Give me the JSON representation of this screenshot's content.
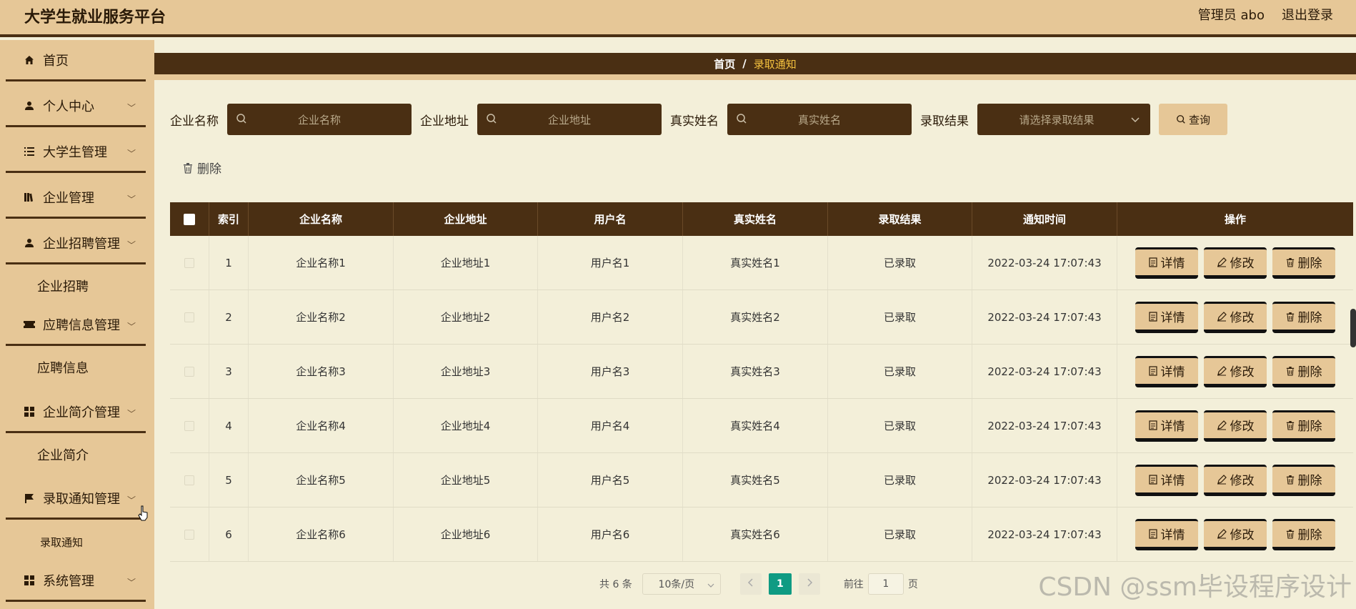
{
  "header": {
    "brand": "大学生就业服务平台",
    "admin": "管理员 abo",
    "logout": "退出登录"
  },
  "sidebar": {
    "items": [
      {
        "label": "首页",
        "icon": "home-icon"
      },
      {
        "label": "个人中心",
        "icon": "user-icon"
      },
      {
        "label": "大学生管理",
        "icon": "list-icon"
      },
      {
        "label": "企业管理",
        "icon": "book-icon"
      },
      {
        "label": "企业招聘管理",
        "icon": "user-icon"
      },
      {
        "label": "企业招聘"
      },
      {
        "label": "应聘信息管理",
        "icon": "ticket-icon"
      },
      {
        "label": "应聘信息"
      },
      {
        "label": "企业简介管理",
        "icon": "grid-icon"
      },
      {
        "label": "企业简介"
      },
      {
        "label": "录取通知管理",
        "icon": "flag-icon"
      },
      {
        "label": "录取通知"
      },
      {
        "label": "系统管理",
        "icon": "grid-icon"
      }
    ]
  },
  "breadcrumb": {
    "home": "首页",
    "sep": "/",
    "current": "录取通知"
  },
  "filter": {
    "company_label": "企业名称",
    "company_ph": "企业名称",
    "address_label": "企业地址",
    "address_ph": "企业地址",
    "realname_label": "真实姓名",
    "realname_ph": "真实姓名",
    "result_label": "录取结果",
    "result_ph": "请选择录取结果",
    "query": "查询"
  },
  "toolbar": {
    "delete": "删除"
  },
  "table": {
    "headers": [
      "索引",
      "企业名称",
      "企业地址",
      "用户名",
      "真实姓名",
      "录取结果",
      "通知时间",
      "操作"
    ],
    "rows": [
      {
        "idx": "1",
        "company": "企业名称1",
        "address": "企业地址1",
        "user": "用户名1",
        "name": "真实姓名1",
        "result": "已录取",
        "time": "2022-03-24 17:07:43"
      },
      {
        "idx": "2",
        "company": "企业名称2",
        "address": "企业地址2",
        "user": "用户名2",
        "name": "真实姓名2",
        "result": "已录取",
        "time": "2022-03-24 17:07:43"
      },
      {
        "idx": "3",
        "company": "企业名称3",
        "address": "企业地址3",
        "user": "用户名3",
        "name": "真实姓名3",
        "result": "已录取",
        "time": "2022-03-24 17:07:43"
      },
      {
        "idx": "4",
        "company": "企业名称4",
        "address": "企业地址4",
        "user": "用户名4",
        "name": "真实姓名4",
        "result": "已录取",
        "time": "2022-03-24 17:07:43"
      },
      {
        "idx": "5",
        "company": "企业名称5",
        "address": "企业地址5",
        "user": "用户名5",
        "name": "真实姓名5",
        "result": "已录取",
        "time": "2022-03-24 17:07:43"
      },
      {
        "idx": "6",
        "company": "企业名称6",
        "address": "企业地址6",
        "user": "用户名6",
        "name": "真实姓名6",
        "result": "已录取",
        "time": "2022-03-24 17:07:43"
      }
    ],
    "actions": {
      "detail": "详情",
      "edit": "修改",
      "delete": "删除"
    }
  },
  "pager": {
    "total": "共 6 条",
    "size": "10条/页",
    "current": "1",
    "goto": "前往",
    "goto_value": "1",
    "page_unit": "页"
  },
  "watermark": "CSDN @ssm毕设程序设计",
  "colors": {
    "brand_bg": "#e6c797",
    "dark": "#4a2f13",
    "accent": "#f5c23e",
    "page_active": "#0f9b83"
  }
}
